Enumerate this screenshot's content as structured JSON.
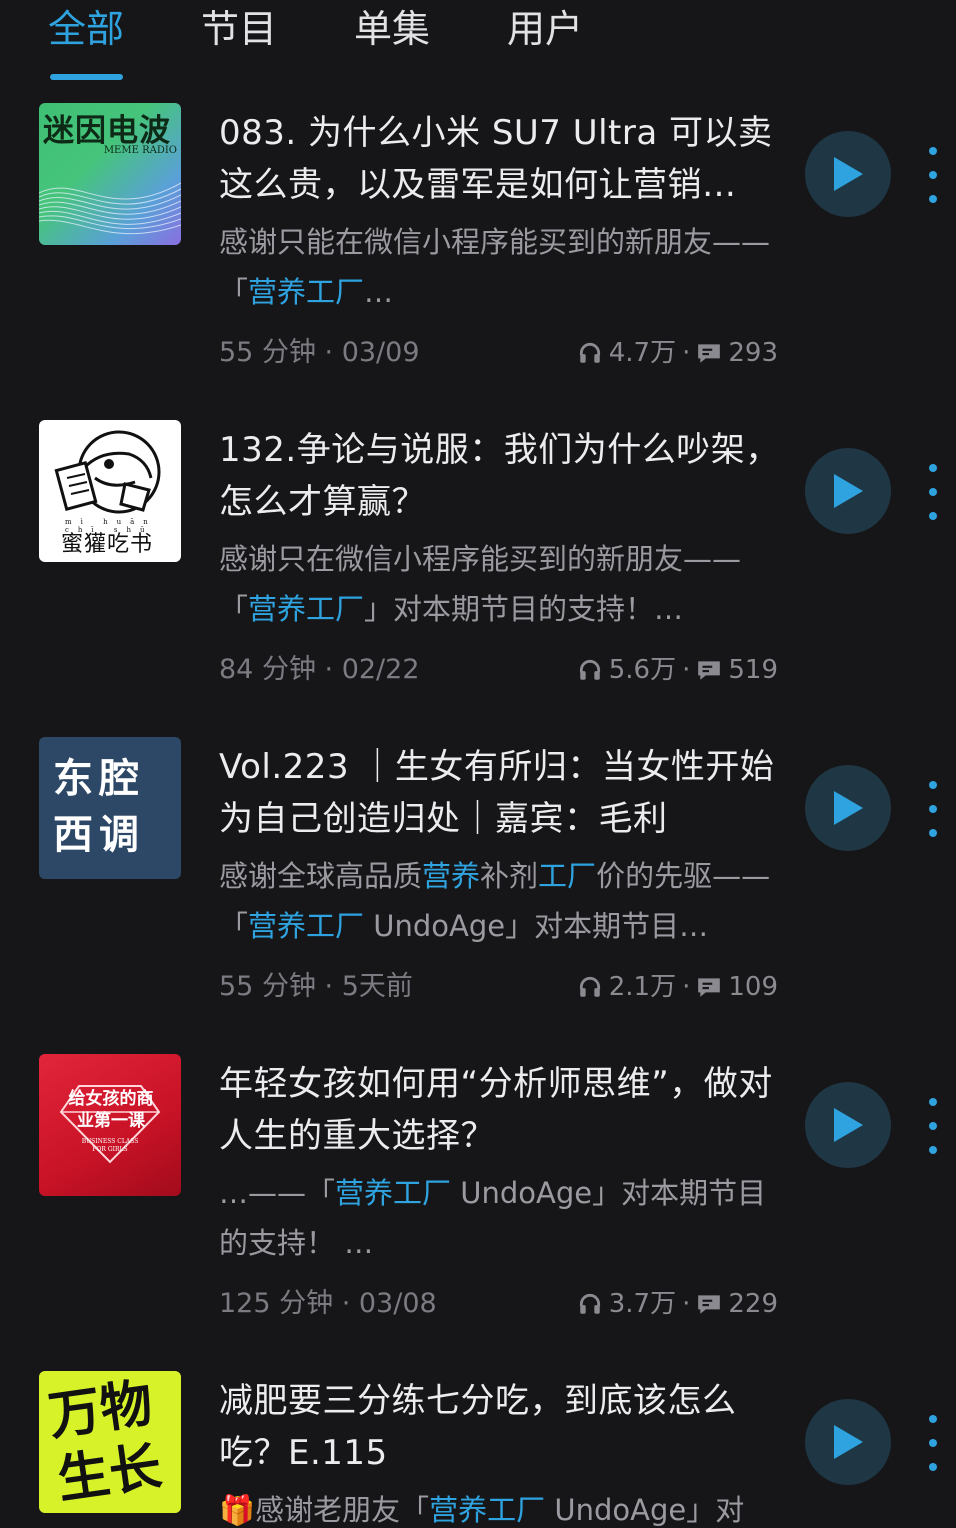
{
  "tabs": [
    {
      "label": "全部",
      "active": true
    },
    {
      "label": "节目",
      "active": false
    },
    {
      "label": "单集",
      "active": false
    },
    {
      "label": "用户",
      "active": false
    }
  ],
  "colors": {
    "accent": "#2fa3df",
    "background": "#161618"
  },
  "episodes": [
    {
      "cover": {
        "title": "迷因电波",
        "subtitle": "MEME RADIO"
      },
      "title": "083. 为什么小米 SU7 Ultra 可以卖这么贵，以及雷军是如何让营销…",
      "desc_pre": "感谢只能在微信小程序能买到的新朋友——「",
      "desc_hl": "营养工厂",
      "desc_post": "…",
      "duration": "55 分钟",
      "date": "03/09",
      "plays": "4.7万",
      "comments": "293"
    },
    {
      "cover": {
        "title": "蜜獾吃书",
        "subtitle": "mì huān chī shū"
      },
      "title": "132.争论与说服：我们为什么吵架，怎么才算赢？",
      "desc_pre": "感谢只在微信小程序能买到的新朋友——「",
      "desc_hl": "营养工厂",
      "desc_post": "」对本期节目的支持！…",
      "duration": "84 分钟",
      "date": "02/22",
      "plays": "5.6万",
      "comments": "519"
    },
    {
      "cover": {
        "title": "东腔西调"
      },
      "title": "Vol.223 ｜生女有所归：当女性开始为自己创造归处｜嘉宾：毛利",
      "desc_pre": "感谢全球高品质",
      "desc_hl": "营养",
      "desc_mid": "补剂",
      "desc_hl2": "工厂",
      "desc_mid2": "价的先驱——「",
      "desc_hl3": "营养工厂",
      "desc_post": " UndoAge」对本期节目…",
      "duration": "55 分钟",
      "date": "5天前",
      "plays": "2.1万",
      "comments": "109"
    },
    {
      "cover": {
        "title": "给女孩的商业第一课",
        "subtitle": "BUSINESS CLASS FOR GIRLS"
      },
      "title": "年轻女孩如何用“分析师思维”，做对人生的重大选择？",
      "desc_pre": "…——「",
      "desc_hl": "营养工厂",
      "desc_post": " UndoAge」对本期节目的支持！ …",
      "duration": "125 分钟",
      "date": "03/08",
      "plays": "3.7万",
      "comments": "229"
    },
    {
      "cover": {
        "title": "万物生长"
      },
      "title": "减肥要三分练七分吃，到底该怎么吃？E.115",
      "desc_pre": "🎁感谢老朋友「",
      "desc_hl": "营养工厂",
      "desc_post": " UndoAge」对"
    }
  ]
}
